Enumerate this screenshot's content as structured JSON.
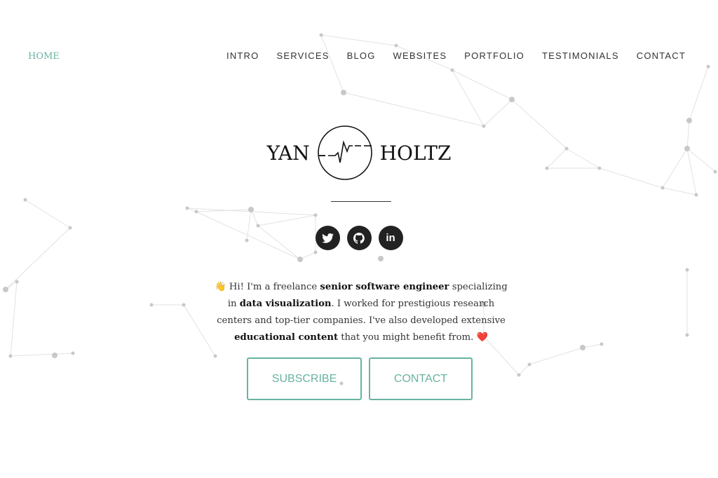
{
  "nav": {
    "home": "HOME",
    "items": [
      "INTRO",
      "SERVICES",
      "BLOG",
      "WEBSITES",
      "PORTFOLIO",
      "TESTIMONIALS",
      "CONTACT"
    ]
  },
  "logo": {
    "first": "YAN",
    "last": "HOLTZ",
    "icon": "heartbeat-circle-icon"
  },
  "social": [
    {
      "icon": "twitter-icon",
      "label": ""
    },
    {
      "icon": "github-icon",
      "label": ""
    },
    {
      "icon": "linkedin-icon",
      "label": "in"
    }
  ],
  "intro": {
    "emoji_start": "👋",
    "t1": " Hi! I'm a freelance ",
    "b1": "senior software engineer",
    "t2": " specializing in ",
    "b2": "data visualization",
    "t3": ". I worked for prestigious research centers and top-tier companies. I've also developed extensive ",
    "b3": "educational content",
    "t4": " that you might benefit from. ",
    "emoji_end": "❤️"
  },
  "buttons": {
    "subscribe": "SUBSCRIBE",
    "contact": "CONTACT"
  },
  "colors": {
    "accent": "#69b3a2",
    "dark": "#222222"
  }
}
